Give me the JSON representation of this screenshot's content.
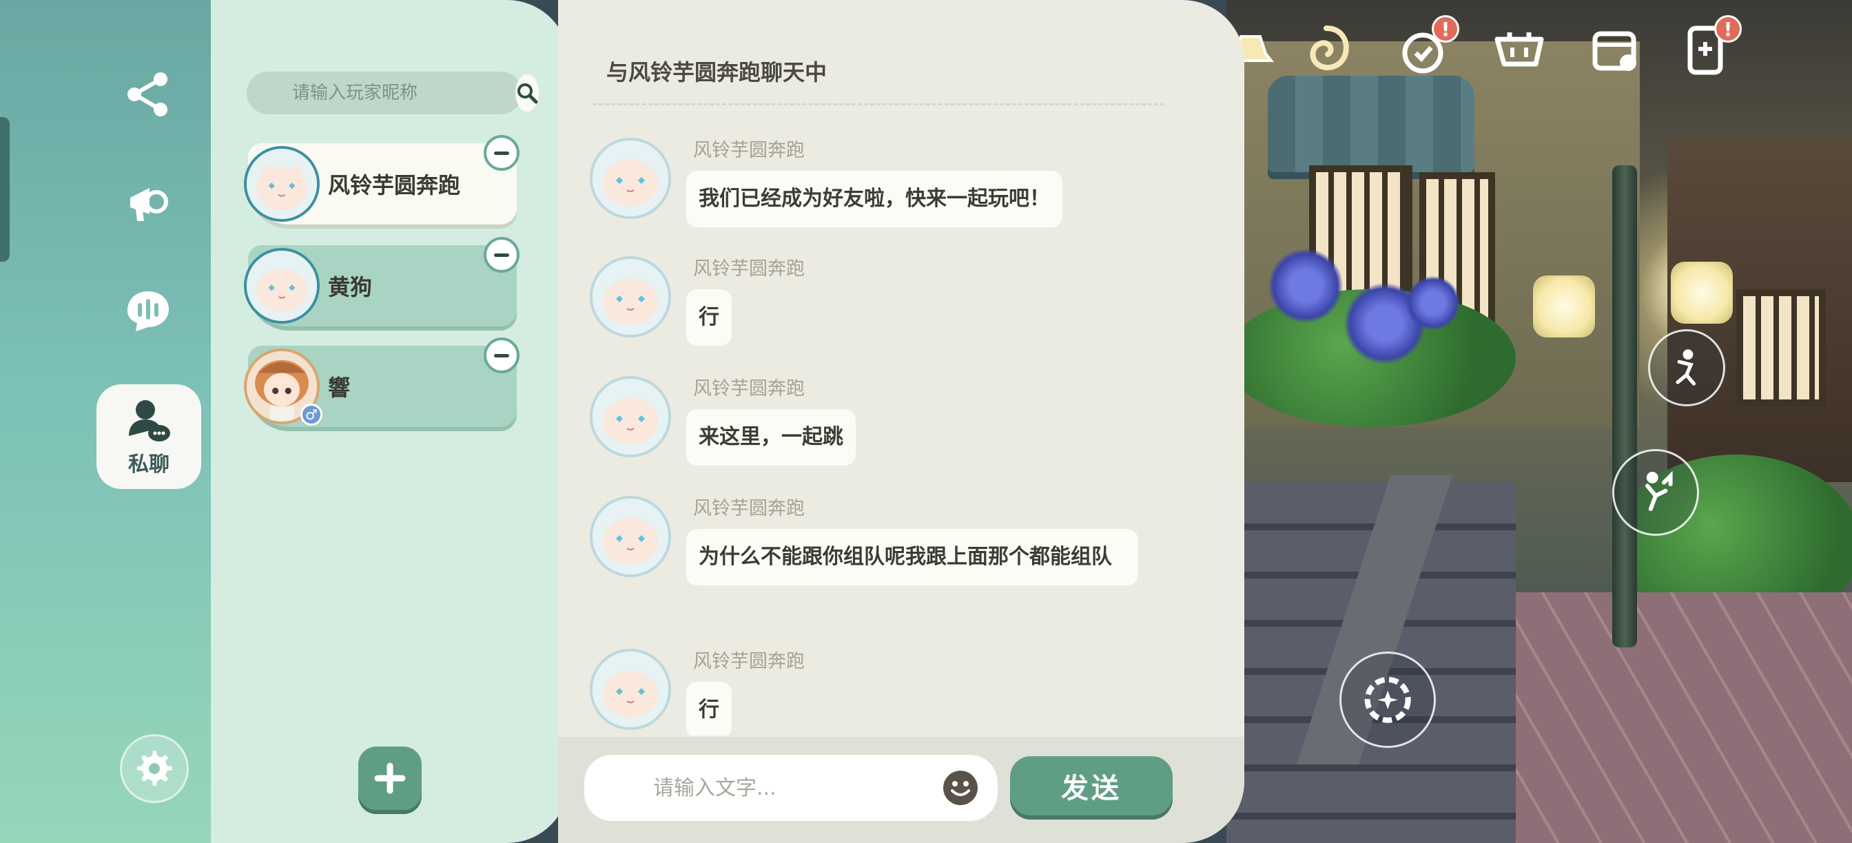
{
  "rail": {
    "items": [
      {
        "icon": "share-icon"
      },
      {
        "icon": "megaphone-icon"
      },
      {
        "icon": "voice-chat-icon"
      }
    ],
    "active_label": "私聊",
    "settings_icon": "gear-icon"
  },
  "friends": {
    "search_placeholder": "请输入玩家昵称",
    "list": [
      {
        "name": "风铃芋圆奔跑",
        "avatar": "cat-avatar",
        "state": "active"
      },
      {
        "name": "黄狗",
        "avatar": "cat-avatar",
        "state": "idle"
      },
      {
        "name": "響",
        "avatar": "girl-avatar",
        "state": "idle",
        "gender": "♂"
      }
    ]
  },
  "chat": {
    "title": "与风铃芋圆奔跑聊天中",
    "messages": [
      {
        "sender": "风铃芋圆奔跑",
        "text": "我们已经成为好友啦，快来一起玩吧！"
      },
      {
        "sender": "风铃芋圆奔跑",
        "text": "行"
      },
      {
        "sender": "风铃芋圆奔跑",
        "text": "来这里，一起跳"
      },
      {
        "sender": "风铃芋圆奔跑",
        "text": "为什么不能跟你组队呢我跟上面那个都能组队"
      },
      {
        "sender": "风铃芋圆奔跑",
        "text": "行"
      }
    ],
    "input_placeholder": "请输入文字...",
    "send_label": "发送"
  },
  "hud": {
    "top_icons": [
      "hat-icon",
      "spiral-icon",
      "gift-icon",
      "shop-cart-icon",
      "calendar-icon",
      "phone-icon"
    ],
    "alert_mark": "!",
    "action_buttons": [
      "dance-icon",
      "jump-icon",
      "emote-wheel-icon"
    ]
  },
  "colors": {
    "accent": "#5f9e85",
    "panel": "#d5ece0",
    "chat_bg": "#ecebe1",
    "alert": "#e06b5b"
  }
}
